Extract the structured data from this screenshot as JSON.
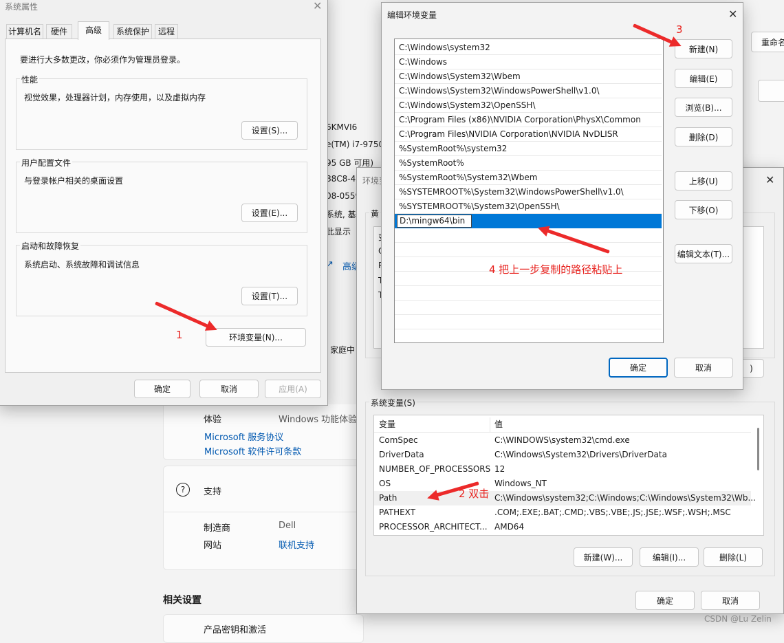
{
  "settings_bg": {
    "right_button_1": "重命名",
    "device_id_frag": "6KMVI6",
    "cpu_frag": "e(TM) i7-9750",
    "ram_frag": "95 GB 可用)",
    "id2_frag": "88C8-4",
    "id3_frag": "08-0559",
    "sys_frag": "系统, 基于",
    "pen_frag": "此显示",
    "adv_link_frag": "高级",
    "home_frag": "家庭中",
    "experience_label": "体验",
    "experience_value": "Windows 功能体验包",
    "ms_service": "Microsoft 服务协议",
    "ms_license": "Microsoft 软件许可条款",
    "support_label": "支持",
    "manufacturer_label": "制造商",
    "manufacturer_value": "Dell",
    "website_label": "网站",
    "website_value": "联机支持",
    "related_settings": "相关设置",
    "related_item_1": "产品密钥和激活"
  },
  "sysprops": {
    "title": "系统属性",
    "tabs": [
      "计算机名",
      "硬件",
      "高级",
      "系统保护",
      "远程"
    ],
    "admin_note": "要进行大多数更改，你必须作为管理员登录。",
    "performance_label": "性能",
    "performance_desc": "视觉效果，处理器计划，内存使用，以及虚拟内存",
    "performance_button": "设置(S)...",
    "profile_label": "用户配置文件",
    "profile_desc": "与登录帐户相关的桌面设置",
    "profile_button": "设置(E)...",
    "startup_label": "启动和故障恢复",
    "startup_desc": "系统启动、系统故障和调试信息",
    "startup_button": "设置(T)...",
    "env_button": "环境变量(N)...",
    "ok": "确定",
    "cancel": "取消",
    "apply": "应用(A)"
  },
  "envvars": {
    "title_frag": "环境变",
    "user_vars_frag": "黄",
    "user_rows_frag": [
      "变",
      "O",
      "P",
      "T",
      "T"
    ],
    "system_vars_label": "系统变量(S)",
    "col_var": "变量",
    "col_val": "值",
    "rows": [
      {
        "name": "ComSpec",
        "value": "C:\\WINDOWS\\system32\\cmd.exe"
      },
      {
        "name": "DriverData",
        "value": "C:\\Windows\\System32\\Drivers\\DriverData"
      },
      {
        "name": "NUMBER_OF_PROCESSORS",
        "value": "12"
      },
      {
        "name": "OS",
        "value": "Windows_NT"
      },
      {
        "name": "Path",
        "value": "C:\\Windows\\system32;C:\\Windows;C:\\Windows\\System32\\Wb..."
      },
      {
        "name": "PATHEXT",
        "value": ".COM;.EXE;.BAT;.CMD;.VBS;.VBE;.JS;.JSE;.WSF;.WSH;.MSC"
      },
      {
        "name": "PROCESSOR_ARCHITECT...",
        "value": "AMD64"
      }
    ],
    "new_button": "新建(W)...",
    "edit_button": "编辑(I)...",
    "delete_button": "删除(L)",
    "ok": "确定",
    "cancel": "取消",
    "partial_btn_frag": ")"
  },
  "editenv": {
    "title": "编辑环境变量",
    "paths": [
      "C:\\Windows\\system32",
      "C:\\Windows",
      "C:\\Windows\\System32\\Wbem",
      "C:\\Windows\\System32\\WindowsPowerShell\\v1.0\\",
      "C:\\Windows\\System32\\OpenSSH\\",
      "C:\\Program Files (x86)\\NVIDIA Corporation\\PhysX\\Common",
      "C:\\Program Files\\NVIDIA Corporation\\NVIDIA NvDLISR",
      "%SystemRoot%\\system32",
      "%SystemRoot%",
      "%SystemRoot%\\System32\\Wbem",
      "%SYSTEMROOT%\\System32\\WindowsPowerShell\\v1.0\\",
      "%SYSTEMROOT%\\System32\\OpenSSH\\"
    ],
    "editing_value": "D:\\mingw64\\bin",
    "buttons": {
      "new": "新建(N)",
      "edit": "编辑(E)",
      "browse": "浏览(B)...",
      "delete": "删除(D)",
      "up": "上移(U)",
      "down": "下移(O)",
      "edit_text": "编辑文本(T)..."
    },
    "ok": "确定",
    "cancel": "取消"
  },
  "annotations": {
    "step1": "1",
    "step2": "2 双击",
    "step3": "3",
    "step4": "4 把上一步复制的路径粘贴上"
  },
  "watermark": "CSDN @Lu Zelin",
  "colors": {
    "accent": "#0067c0",
    "selection": "#0078d7",
    "annotation_red": "#e8231f"
  }
}
